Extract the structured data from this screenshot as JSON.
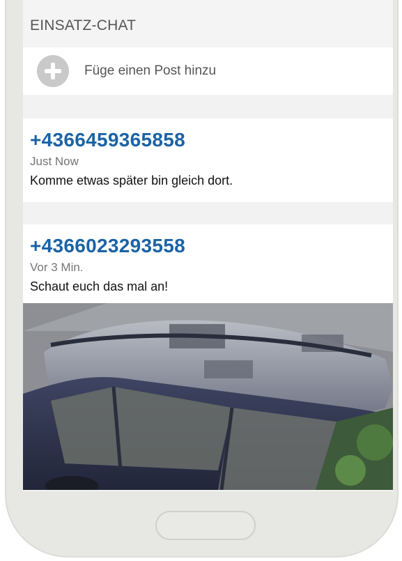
{
  "chat": {
    "section_title": "EINSATZ-CHAT",
    "add_post_label": "Füge einen Post hinzu",
    "add_icon": "plus-circle-icon"
  },
  "posts": [
    {
      "sender": "+4366459365858",
      "time": "Just Now",
      "text": "Komme etwas später bin gleich dort."
    },
    {
      "sender": "+4366023293558",
      "time": "Vor 3 Min.",
      "text": "Schaut euch das mal an!",
      "image": "car-roof-photo"
    }
  ],
  "colors": {
    "accent": "#1b63a5",
    "header_bg": "#f4f4f4",
    "phone_frame": "#e7e7e3"
  }
}
